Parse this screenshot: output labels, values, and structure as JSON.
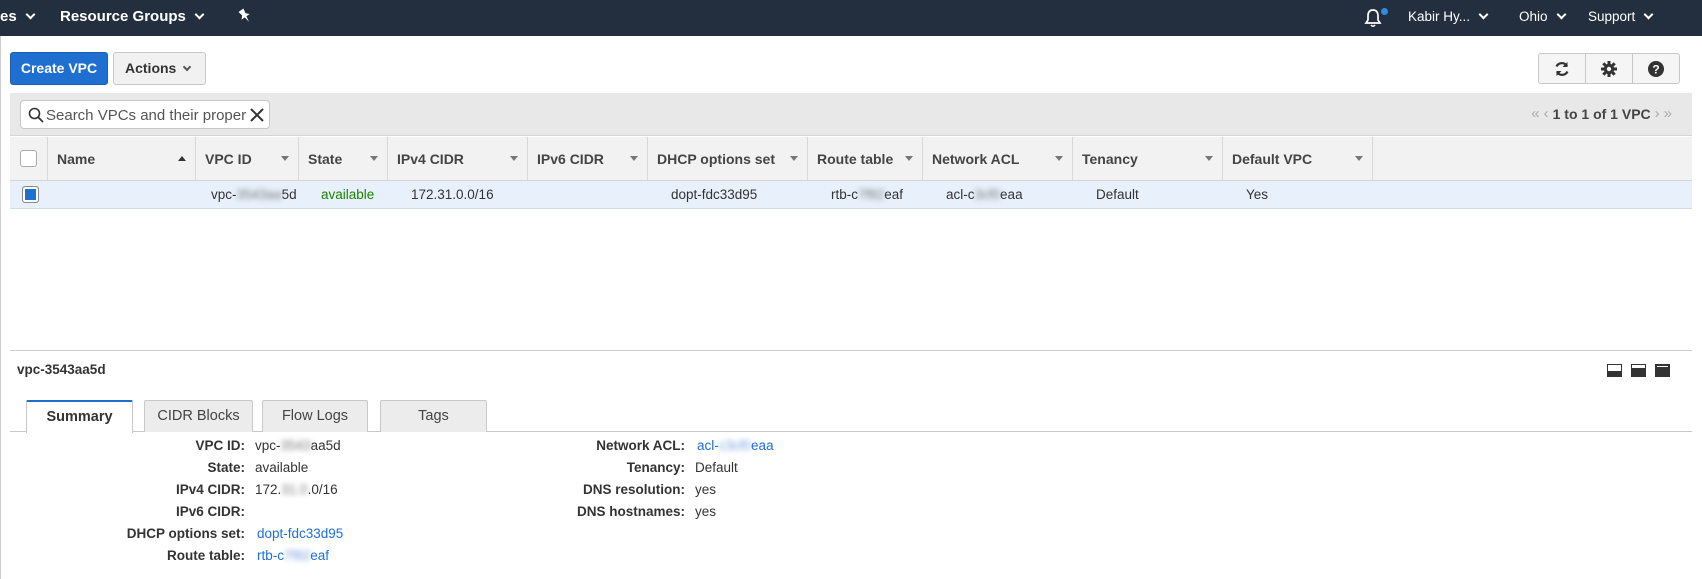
{
  "topnav": {
    "services_label": "es",
    "resource_groups_label": "Resource Groups",
    "user_label": "Kabir Hy...",
    "region_label": "Ohio",
    "support_label": "Support"
  },
  "toolbar": {
    "create_label": "Create VPC",
    "actions_label": "Actions"
  },
  "filter": {
    "search_placeholder": "Search VPCs and their proper",
    "pager_text": "1 to 1 of 1 VPC"
  },
  "table": {
    "columns": [
      "Name",
      "VPC ID",
      "State",
      "IPv4 CIDR",
      "IPv6 CIDR",
      "DHCP options set",
      "Route table",
      "Network ACL",
      "Tenancy",
      "Default VPC"
    ],
    "row": {
      "name": "",
      "vpc_id_prefix": "vpc-",
      "vpc_id_hidden": "3543aa",
      "vpc_id_suffix": "5d",
      "state": "available",
      "ipv4": "172.31.0.0/16",
      "ipv6": "",
      "dhcp": "dopt-fdc33d95",
      "rt_prefix": "rtb-c",
      "rt_hidden": "7f82",
      "rt_suffix": "eaf",
      "acl_prefix": "acl-c",
      "acl_hidden": "3cf0",
      "acl_suffix": "eaa",
      "tenancy": "Default",
      "default_vpc": "Yes"
    }
  },
  "details": {
    "title": "vpc-3543aa5d",
    "tabs": [
      "Summary",
      "CIDR Blocks",
      "Flow Logs",
      "Tags"
    ],
    "left": {
      "vpc_id_label": "VPC ID:",
      "vpc_id_prefix": "vpc-",
      "vpc_id_hidden": "3543",
      "vpc_id_suffix": "aa5d",
      "state_label": "State:",
      "state_value": "available",
      "ipv4_label": "IPv4 CIDR:",
      "ipv4_prefix": "172.",
      "ipv4_hidden": "31.0",
      "ipv4_suffix": ".0/16",
      "ipv6_label": "IPv6 CIDR:",
      "ipv6_value": "",
      "dhcp_label": "DHCP options set:",
      "dhcp_value": "dopt-fdc33d95",
      "rt_label": "Route table:",
      "rt_prefix": "rtb-c",
      "rt_hidden": "7f82",
      "rt_suffix": "eaf"
    },
    "right": {
      "acl_label": "Network ACL:",
      "acl_prefix": "acl-",
      "acl_hidden": "c3cf0",
      "acl_suffix": "eaa",
      "tenancy_label": "Tenancy:",
      "tenancy_value": "Default",
      "dns_res_label": "DNS resolution:",
      "dns_res_value": "yes",
      "dns_host_label": "DNS hostnames:",
      "dns_host_value": "yes"
    }
  },
  "colors": {
    "nav_bg": "#232f3e",
    "primary": "#1f6fd0",
    "available": "#1d8102",
    "selected_row": "#e8f1fb"
  }
}
